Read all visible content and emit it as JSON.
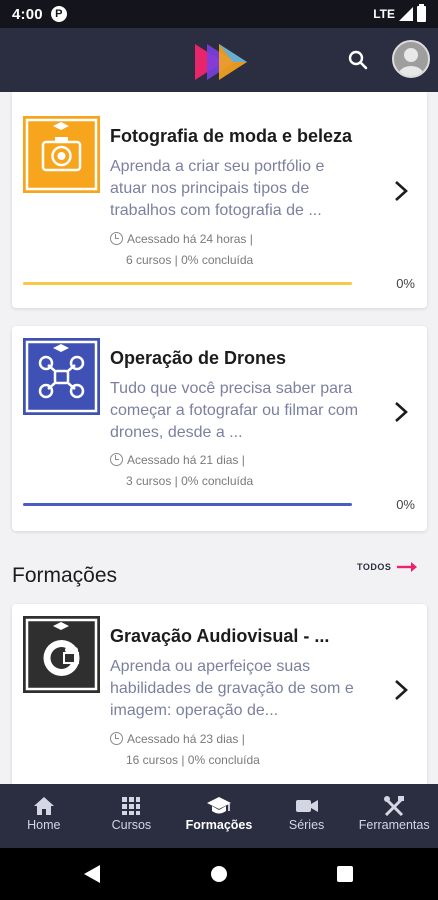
{
  "status_bar": {
    "time": "4:00",
    "app_icon": "P",
    "network": "LTE"
  },
  "app_bar": {
    "logo": "play-logo",
    "search_icon": "search-icon",
    "avatar": "user-avatar"
  },
  "courses": [
    {
      "title": "Fotografia de moda e beleza",
      "description": "Aprenda a criar seu portfólio e atuar nos principais tipos de trabalhos com fotografia de ...",
      "accessed": "Acessado há 24 horas |",
      "stats": "6 cursos | 0% concluída",
      "progress": 0,
      "progress_label": "0%",
      "accent": "#f7a51c",
      "icon": "camera-icon"
    },
    {
      "title": "Operação de Drones",
      "description": "Tudo que você precisa saber para começar a fotografar ou filmar com drones, desde a ...",
      "accessed": "Acessado há 21 dias |",
      "stats": "3 cursos | 0% concluída",
      "progress": 0,
      "progress_label": "0%",
      "accent": "#3f51b5",
      "icon": "drone-icon"
    }
  ],
  "section": {
    "title": "Formações",
    "all_label": "TODOS",
    "all_arrow_color": "#e8246b"
  },
  "formations": [
    {
      "title": "Gravação Audiovisual - ...",
      "description": "Aprenda ou aperfeiçoe suas habilidades de gravação de som e imagem: operação de...",
      "accessed": "Acessado há 23 dias |",
      "stats": "16 cursos | 0% concluída",
      "accent": "#2f2f2f",
      "icon": "film-camera-icon"
    }
  ],
  "bottom_nav": [
    {
      "label": "Home",
      "icon": "home-icon",
      "active": false
    },
    {
      "label": "Cursos",
      "icon": "grid-icon",
      "active": false
    },
    {
      "label": "Formações",
      "icon": "graduation-cap-icon",
      "active": true
    },
    {
      "label": "Séries",
      "icon": "video-camera-icon",
      "active": false
    },
    {
      "label": "Ferramentas",
      "icon": "tools-icon",
      "active": false
    }
  ]
}
